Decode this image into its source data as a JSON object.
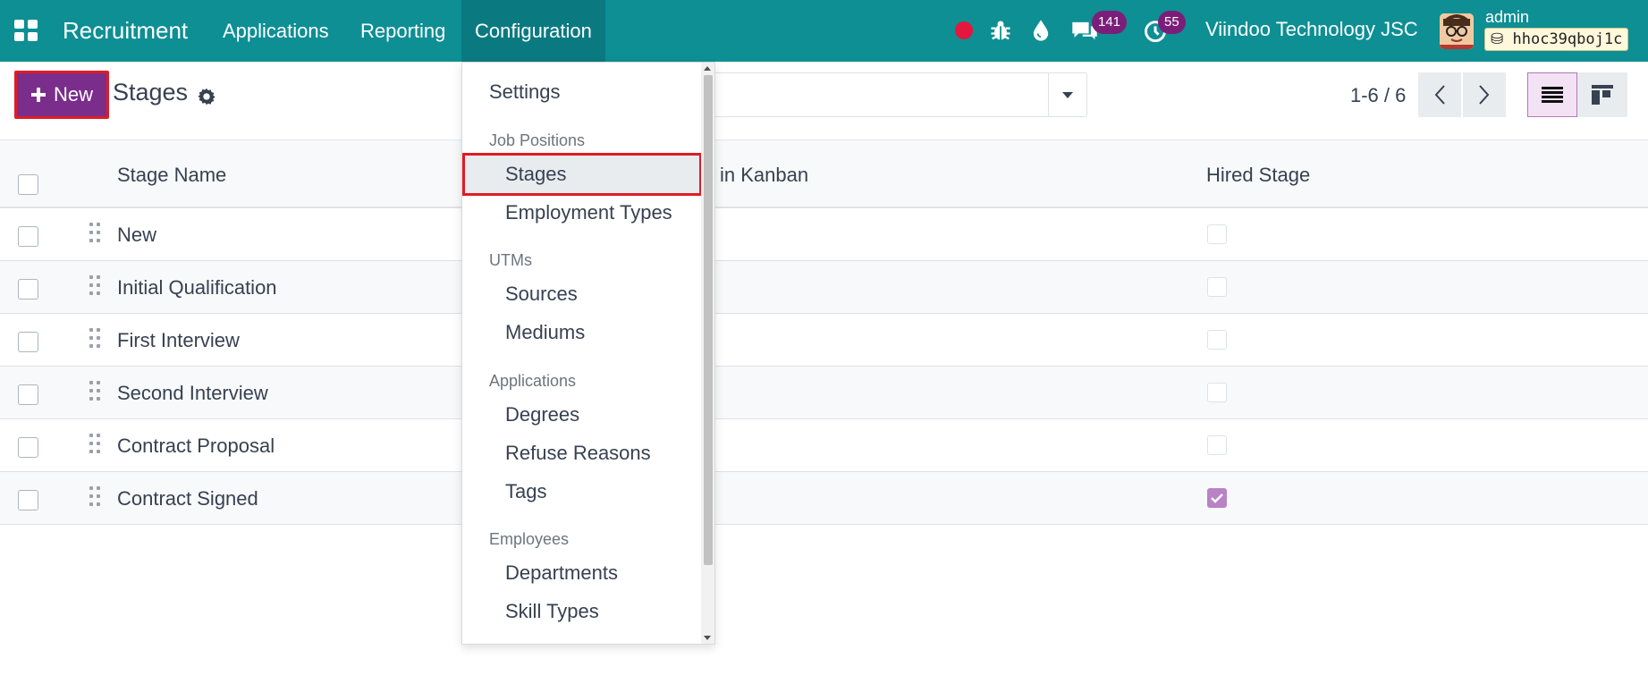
{
  "navbar": {
    "brand": "Recruitment",
    "menu": [
      "Applications",
      "Reporting",
      "Configuration"
    ],
    "active_menu": "Configuration",
    "messages_count": "141",
    "activities_count": "55",
    "company": "Viindoo Technology JSC",
    "user": "admin",
    "database": "hhoc39qboj1c"
  },
  "control": {
    "new_label": "New",
    "title": "Stages",
    "pager": "1-6 / 6"
  },
  "table": {
    "columns": [
      "Stage Name",
      "in Kanban",
      "Hired Stage"
    ],
    "rows": [
      {
        "name": "New",
        "hired": false
      },
      {
        "name": "Initial Qualification",
        "hired": false
      },
      {
        "name": "First Interview",
        "hired": false
      },
      {
        "name": "Second Interview",
        "hired": false
      },
      {
        "name": "Contract Proposal",
        "hired": false
      },
      {
        "name": "Contract Signed",
        "hired": true
      }
    ]
  },
  "dropdown": {
    "settings": "Settings",
    "sections": [
      {
        "header": "Job Positions",
        "items": [
          "Stages",
          "Employment Types"
        ]
      },
      {
        "header": "UTMs",
        "items": [
          "Sources",
          "Mediums"
        ]
      },
      {
        "header": "Applications",
        "items": [
          "Degrees",
          "Refuse Reasons",
          "Tags"
        ]
      },
      {
        "header": "Employees",
        "items": [
          "Departments",
          "Skill Types"
        ]
      }
    ],
    "highlighted": "Stages"
  },
  "colors": {
    "navbar": "#0d8f94",
    "primary": "#7b2d8b",
    "highlight_border": "#e01b24",
    "badge": "#7b1e7a"
  }
}
